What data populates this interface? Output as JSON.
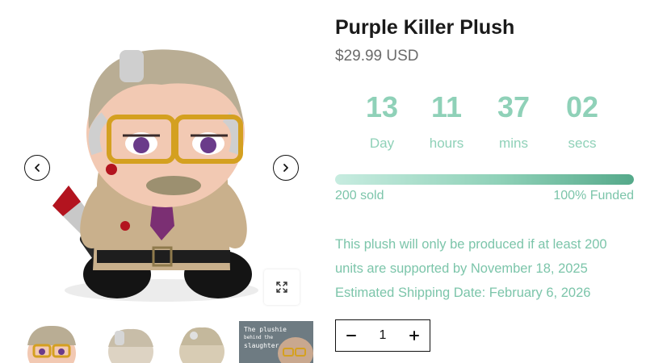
{
  "product": {
    "title": "Purple Killer Plush",
    "price": "$29.99 USD"
  },
  "countdown": [
    {
      "value": "13",
      "label": "Day"
    },
    {
      "value": "11",
      "label": "hours"
    },
    {
      "value": "37",
      "label": "mins"
    },
    {
      "value": "02",
      "label": "secs"
    }
  ],
  "funding": {
    "sold": "200 sold",
    "funded": "100% Funded",
    "progress_percent": 100
  },
  "notice": {
    "line1": "This plush will only be produced if at least 200",
    "line2": "units are supported by November 18, 2025",
    "line3": "Estimated Shipping Date: February 6, 2026"
  },
  "quantity": {
    "value": "1"
  },
  "gallery": {
    "thumb4_line1": "The plushie",
    "thumb4_line2": "behind the",
    "thumb4_line3": "slaughter"
  },
  "colors": {
    "accent": "#8fd1b8",
    "accent_dark": "#55a98a",
    "title": "#1a1a1a",
    "price": "#6b6b6b"
  },
  "icons": {
    "prev": "chevron-left-icon",
    "next": "chevron-right-icon",
    "zoom": "expand-icon",
    "minus": "minus-icon",
    "plus": "plus-icon"
  }
}
